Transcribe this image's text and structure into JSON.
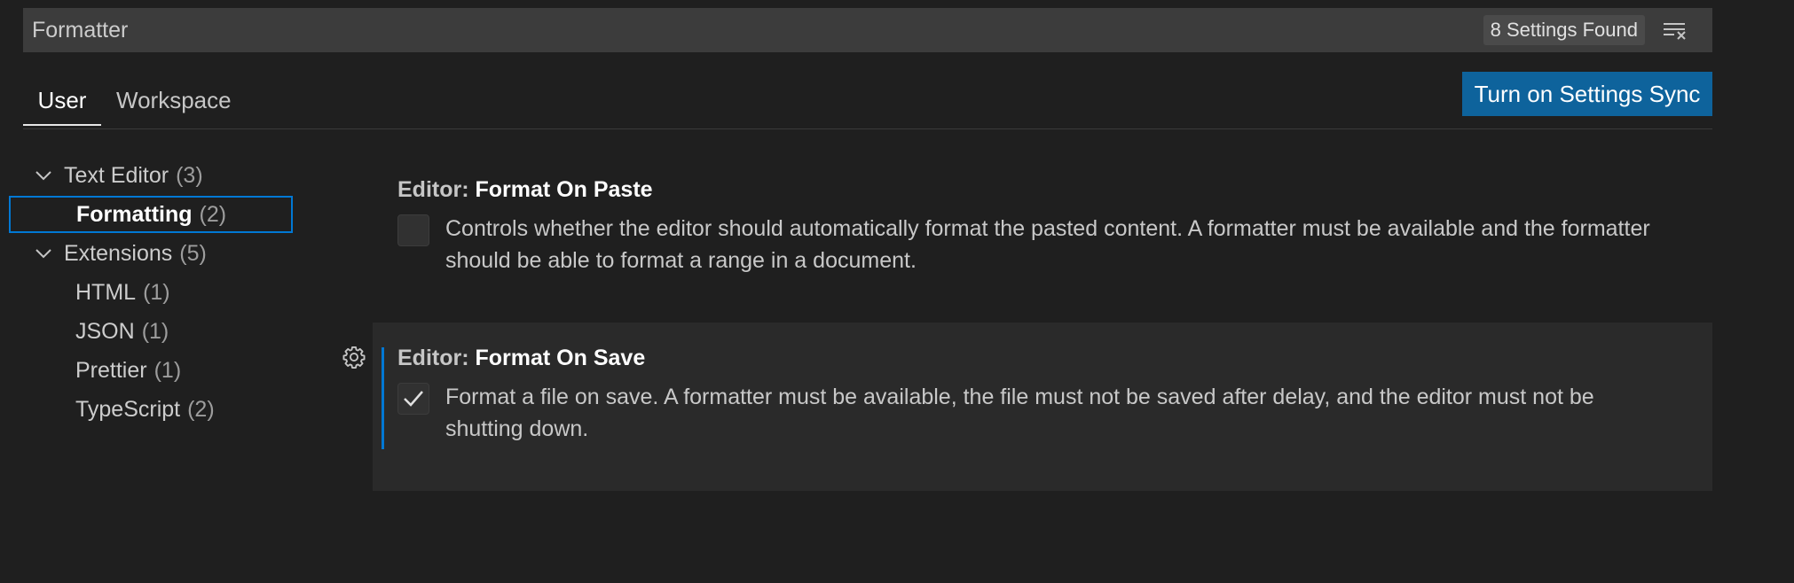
{
  "search": {
    "value": "Formatter",
    "results_count": "8 Settings Found"
  },
  "tabs": [
    {
      "label": "User",
      "active": true
    },
    {
      "label": "Workspace",
      "active": false
    }
  ],
  "sync_button": {
    "label": "Turn on Settings Sync"
  },
  "tree": [
    {
      "label": "Text Editor",
      "count": "(3)",
      "expanded": true,
      "selected": false
    },
    {
      "label": "Formatting",
      "count": "(2)",
      "selected": true
    },
    {
      "label": "Extensions",
      "count": "(5)",
      "expanded": true,
      "selected": false
    },
    {
      "label": "HTML",
      "count": "(1)",
      "selected": false
    },
    {
      "label": "JSON",
      "count": "(1)",
      "selected": false
    },
    {
      "label": "Prettier",
      "count": "(1)",
      "selected": false
    },
    {
      "label": "TypeScript",
      "count": "(2)",
      "selected": false
    }
  ],
  "settings": [
    {
      "category": "Editor:",
      "name": "Format On Paste",
      "description": "Controls whether the editor should automatically format the pasted content. A formatter must be available and the formatter should be able to format a range in a document.",
      "checked": false
    },
    {
      "category": "Editor:",
      "name": "Format On Save",
      "description": "Format a file on save. A formatter must be available, the file must not be saved after delay, and the editor must not be shutting down.",
      "checked": true
    }
  ],
  "colors": {
    "accent": "#0078d4",
    "button": "#0e639c",
    "background": "#1f1f1f"
  },
  "icons": {
    "clear": "clear-filter-icon",
    "chevron": "chevron-down-icon",
    "gear": "gear-icon",
    "check": "check-icon"
  }
}
